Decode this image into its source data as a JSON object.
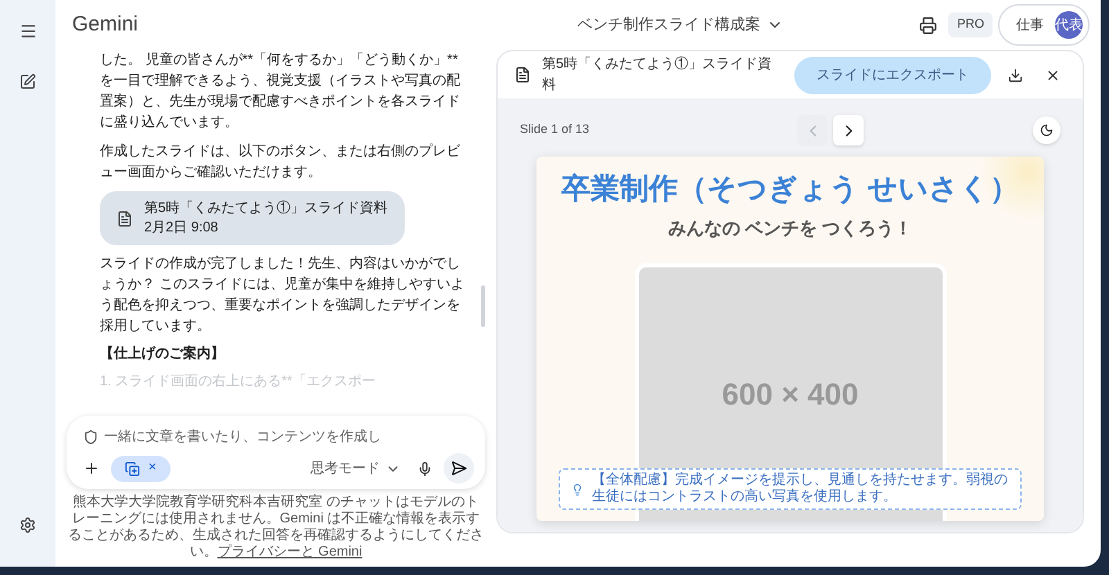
{
  "app": {
    "title": "Gemini"
  },
  "header": {
    "conversation_title": "ベンチ制作スライド構成案",
    "plan_badge": "PRO",
    "account": {
      "label": "仕事",
      "avatar_text": "代表"
    }
  },
  "chat": {
    "messages": [
      {
        "kind": "paragraph",
        "text": "した。 児童の皆さんが**「何をするか」「どう動くか」**を一目で理解できるよう、視覚支援（イラストや写真の配置案）と、先生が現場で配慮すべきポイントを各スライドに盛り込んでいます。"
      },
      {
        "kind": "paragraph",
        "text": "作成したスライドは、以下のボタン、または右側のプレビュー画面からご確認いただけます。"
      },
      {
        "kind": "attachment",
        "title": "第5時「くみたてよう①」スライド資料",
        "date": "2月2日 9:08"
      },
      {
        "kind": "paragraph",
        "text": "スライドの作成が完了しました！先生、内容はいかがでしょうか？ このスライドには、児童が集中を維持しやすいよう配色を抑えつつ、重要なポイントを強調したデザインを採用しています。"
      },
      {
        "kind": "heading",
        "text": "【仕上げのご案内】"
      },
      {
        "kind": "faded",
        "text": "1. スライド画面の右上にある**「エクスポー"
      }
    ]
  },
  "input": {
    "placeholder": "一緒に文章を書いたり、コンテンツを作成し",
    "chip_close": "×",
    "mode": "思考モード"
  },
  "disclaimer": {
    "text": "熊本大学大学院教育学研究科本吉研究室 のチャットはモデルのトレーニングには使用されません。Gemini は不正確な情報を表示することがあるため、生成された回答を再確認するようにしてください。",
    "link": "プライバシーと Gemini"
  },
  "preview": {
    "title": "第5時「くみたてよう①」スライド資料",
    "export_button": "スライドにエクスポート",
    "slide_counter": "Slide 1 of 13",
    "nav": [
      {
        "kind": "prev",
        "disabled": true
      },
      {
        "kind": "next",
        "disabled": false
      }
    ],
    "slide": {
      "title": "卒業制作（そつぎょう せいさく）",
      "subtitle": "みんなの ベンチを つくろう！",
      "image_placeholder": "600 × 400",
      "note": "【全体配慮】完成イメージを提示し、見通しを持たせます。弱視の生徒にはコントラストの高い写真を使用します。"
    }
  }
}
